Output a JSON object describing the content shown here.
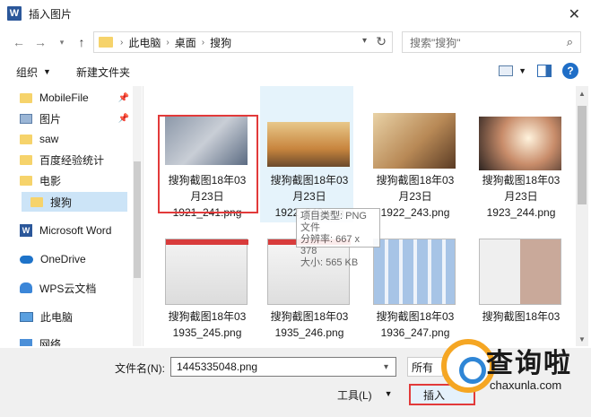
{
  "window": {
    "title": "插入图片",
    "app_icon": "W"
  },
  "address": {
    "crumbs": [
      "此电脑",
      "桌面",
      "搜狗"
    ],
    "search_placeholder": "搜索\"搜狗\""
  },
  "toolbar": {
    "organize": "组织",
    "new_folder": "新建文件夹"
  },
  "sidebar": {
    "items": [
      {
        "label": "MobileFile",
        "icon": "folder-icon",
        "pinned": true
      },
      {
        "label": "图片",
        "icon": "pictures-icon",
        "pinned": true
      },
      {
        "label": "saw",
        "icon": "folder-icon"
      },
      {
        "label": "百度经验统计",
        "icon": "folder-icon"
      },
      {
        "label": "电影",
        "icon": "folder-icon"
      },
      {
        "label": "搜狗",
        "icon": "folder-icon",
        "selected": true
      },
      {
        "label": "Microsoft Word",
        "icon": "word-icon"
      },
      {
        "label": "OneDrive",
        "icon": "cloud-icon"
      },
      {
        "label": "WPS云文档",
        "icon": "wps-icon"
      },
      {
        "label": "此电脑",
        "icon": "pc-icon"
      },
      {
        "label": "网络",
        "icon": "network-icon"
      }
    ]
  },
  "files": [
    {
      "line1": "搜狗截图18年03",
      "line2": "月23日",
      "line3": "1921_241.png"
    },
    {
      "line1": "搜狗截图18年03",
      "line2": "月23日",
      "line3": "1922_242.png"
    },
    {
      "line1": "搜狗截图18年03",
      "line2": "月23日",
      "line3": "1922_243.png"
    },
    {
      "line1": "搜狗截图18年03",
      "line2": "月23日",
      "line3": "1923_244.png"
    },
    {
      "line1": "搜狗截图18年03",
      "line2": "",
      "line3": "1935_245.png"
    },
    {
      "line1": "搜狗截图18年03",
      "line2": "",
      "line3": "1935_246.png"
    },
    {
      "line1": "搜狗截图18年03",
      "line2": "",
      "line3": "1936_247.png"
    },
    {
      "line1": "搜狗截图18年03",
      "line2": "",
      "line3": ""
    }
  ],
  "tooltip": {
    "type": "项目类型: PNG 文件",
    "dimensions": "分辨率: 667 x 378",
    "size": "大小: 565 KB"
  },
  "bottom": {
    "filename_label": "文件名(N):",
    "filename_value": "1445335048.png",
    "filter_value": "所有",
    "tools": "工具(L)",
    "insert": "插入"
  },
  "watermark": {
    "text": "查询啦",
    "url": "chaxunla.com"
  }
}
